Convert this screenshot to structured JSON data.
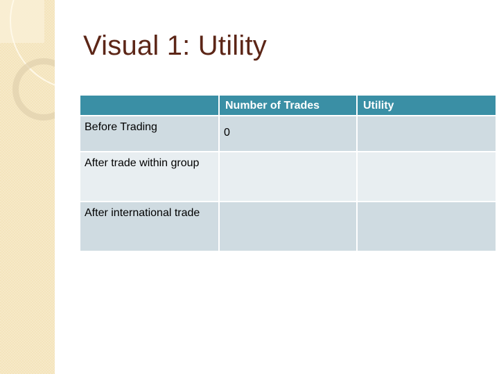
{
  "slide": {
    "title": "Visual 1: Utility"
  },
  "table": {
    "headers": [
      "",
      "Number of Trades",
      "Utility"
    ],
    "rows": [
      {
        "label": "Before Trading",
        "number_of_trades": "0",
        "utility": ""
      },
      {
        "label": "After trade within group",
        "number_of_trades": "",
        "utility": ""
      },
      {
        "label": "After international trade",
        "number_of_trades": "",
        "utility": ""
      }
    ]
  },
  "colors": {
    "title": "#5c2617",
    "header_bg": "#3a8fa5",
    "row_dark": "#cfdbe1",
    "row_light": "#e8eef1",
    "side_strip": "#f4e4bc"
  }
}
